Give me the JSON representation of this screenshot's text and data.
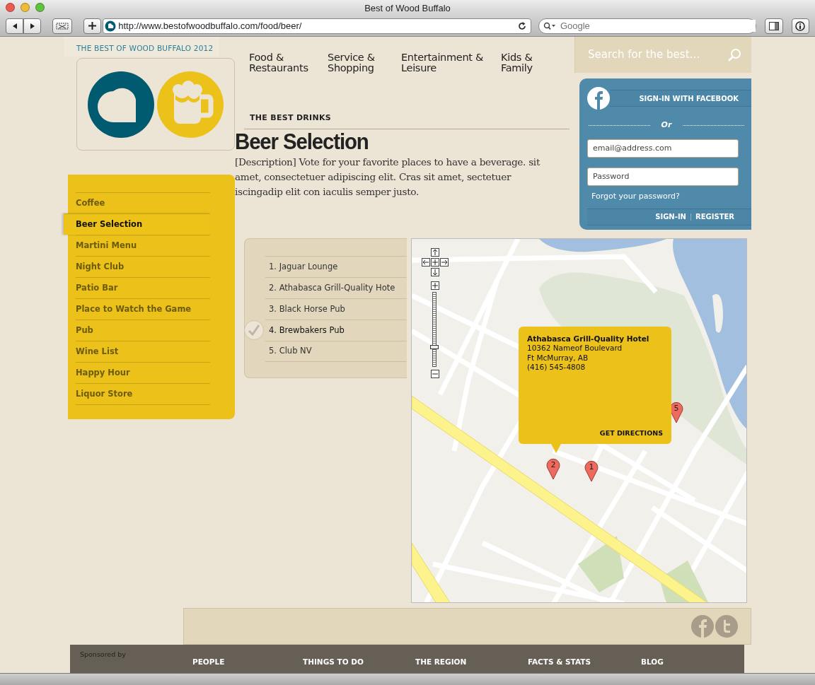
{
  "browser": {
    "title": "Best of Wood Buffalo",
    "url": "http://www.bestofwoodbuffalo.com/food/beer/",
    "search_placeholder": "Google"
  },
  "site": {
    "tagline": "THE BEST OF WOOD BUFFALO 2012"
  },
  "nav": [
    {
      "label": "Food &\nRestaurants"
    },
    {
      "label": "Service &\nShopping"
    },
    {
      "label": "Entertainment &\nLeisure"
    },
    {
      "label": "Kids &\nFamily"
    }
  ],
  "section": {
    "eyebrow": "THE BEST DRINKS",
    "title": "Beer Selection",
    "description": "[Description] Vote for your favorite places to have a beverage. sit amet, consectetuer adipiscing elit. Cras sit amet, sectetuer iscingadip elit con iaculis semper justo."
  },
  "search": {
    "placeholder": "Search for the best…"
  },
  "login": {
    "facebook_button": "SIGN-IN WITH FACEBOOK",
    "divider": "Or",
    "email_placeholder": "email@address.com",
    "password_placeholder": "Password",
    "forgot": "Forgot your password?",
    "sign_in": "SIGN-IN",
    "register": "REGISTER"
  },
  "sidebar": {
    "items": [
      {
        "label": "Coffee",
        "selected": false
      },
      {
        "label": "Beer Selection",
        "selected": true
      },
      {
        "label": "Martini Menu",
        "selected": false
      },
      {
        "label": "Night Club",
        "selected": false
      },
      {
        "label": "Patio Bar",
        "selected": false
      },
      {
        "label": "Place to Watch the Game",
        "selected": false
      },
      {
        "label": "Pub",
        "selected": false
      },
      {
        "label": "Wine List",
        "selected": false
      },
      {
        "label": "Happy Hour",
        "selected": false
      },
      {
        "label": "Liquor Store",
        "selected": false
      }
    ]
  },
  "places": [
    {
      "label": "1. Jaguar Lounge",
      "selected": false
    },
    {
      "label": "2. Athabasca Grill-Quality Hote",
      "selected": false
    },
    {
      "label": "3. Black Horse Pub",
      "selected": false
    },
    {
      "label": "4. Brewbakers Pub",
      "selected": true
    },
    {
      "label": "5. Club NV",
      "selected": false
    }
  ],
  "map": {
    "zoom_slider": {
      "level": 0.26
    },
    "markers": [
      {
        "label": "2"
      },
      {
        "label": "1"
      },
      {
        "label": "5"
      }
    ],
    "popup": {
      "name": "Athabasca Grill-Quality Hotel",
      "address": "10362 Nameof Boulevard",
      "city": "Ft McMurray, AB",
      "phone": "(416) 545-4808",
      "action": "GET DIRECTIONS"
    }
  },
  "footer": {
    "sponsored": "Sponsored by",
    "links": [
      "PEOPLE",
      "THINGS TO DO",
      "THE REGION",
      "FACTS & STATS",
      "BLOG"
    ]
  }
}
